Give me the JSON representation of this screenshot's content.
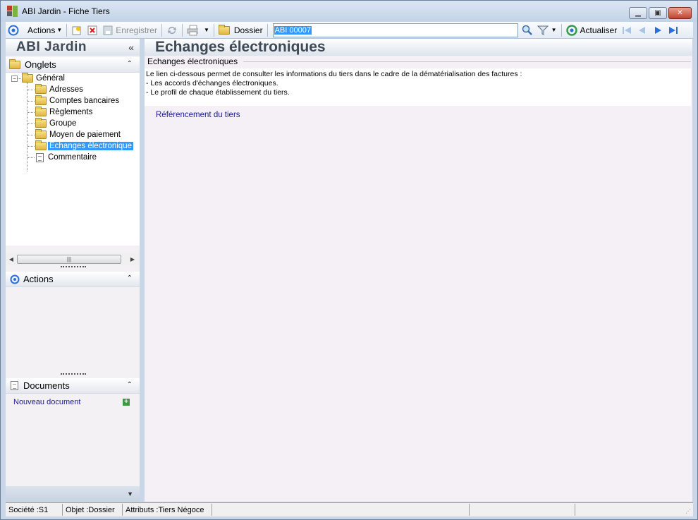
{
  "window": {
    "app_name": "ABI Jardin",
    "separator": " - ",
    "doc_name": "Fiche Tiers",
    "min_icon": "minimize-icon",
    "max_icon": "maximize-icon",
    "close_icon": "close-icon"
  },
  "toolbar": {
    "actions_label": "Actions",
    "save_label": "Enregistrer",
    "folder_label": "Dossier",
    "search_value": "ABI 00007",
    "refresh_label": "Actualiser"
  },
  "left": {
    "header_title": "ABI Jardin",
    "collapse_glyph": "«",
    "tabs_section": "Onglets",
    "tree": {
      "root": "Général",
      "items": [
        "Adresses",
        "Comptes bancaires",
        "Règlements",
        "Groupe",
        "Moyen de paiement",
        "Echanges électronique",
        "Commentaire"
      ]
    },
    "actions_section": "Actions",
    "documents_section": "Documents",
    "new_document_label": "Nouveau document"
  },
  "main": {
    "title": "Echanges électroniques",
    "group_title": "Echanges électroniques",
    "info_lines": [
      "Le lien ci-dessous permet de consulter les informations du tiers dans le cadre de la dématérialisation des factures :",
      "- Les accords d'échanges électroniques.",
      "- Le profil de chaque établissement du tiers."
    ],
    "ref_link": "Référencement du tiers"
  },
  "statusbar": {
    "societe": "Société :S1",
    "objet": "Objet :Dossier",
    "attributs": "Attributs :Tiers Négoce"
  },
  "colors": {
    "selection": "#3399ff",
    "link": "#1a1a8c",
    "accent": "#2a6fd6"
  }
}
